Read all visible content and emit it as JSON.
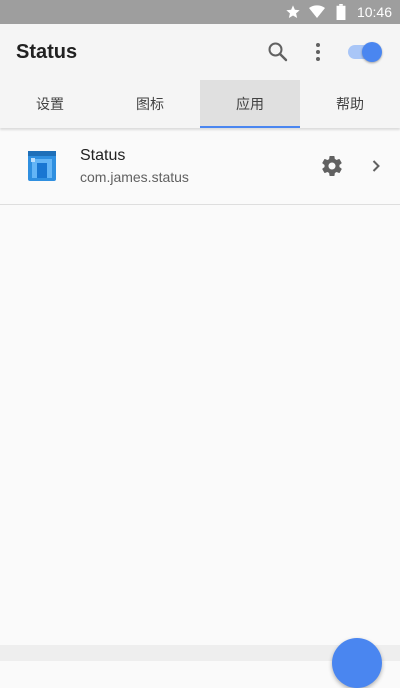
{
  "status_bar": {
    "time": "10:46",
    "icons": [
      "star-icon",
      "wifi-icon",
      "battery-icon"
    ]
  },
  "appbar": {
    "title": "Status",
    "actions": [
      "search-icon",
      "more-vert-icon"
    ],
    "toggle_on": true
  },
  "tabs": [
    {
      "label": "设置",
      "active": false
    },
    {
      "label": "图标",
      "active": false
    },
    {
      "label": "应用",
      "active": true
    },
    {
      "label": "帮助",
      "active": false
    }
  ],
  "apps": [
    {
      "name": "Status",
      "package": "com.james.status"
    }
  ],
  "colors": {
    "accent": "#4a86f0",
    "status_bar": "#9e9e9e",
    "appbar": "#f5f5f5"
  }
}
